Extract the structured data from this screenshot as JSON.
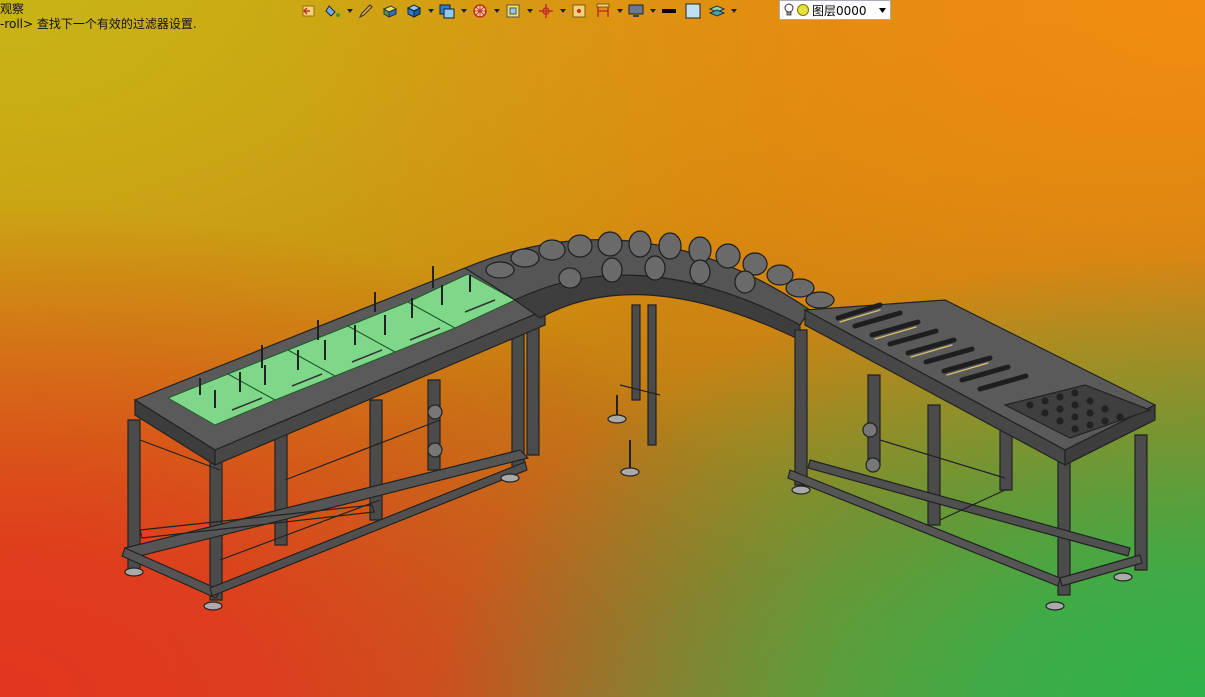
{
  "status": {
    "line1": "观察",
    "line2": "-roll> 查找下一个有效的过滤器设置."
  },
  "toolbar": {
    "buttons": [
      {
        "icon": "view-back-icon",
        "dropdown": false
      },
      {
        "icon": "paint-bucket-icon",
        "dropdown": true
      },
      {
        "icon": "pen-edit-icon",
        "dropdown": false
      },
      {
        "icon": "shaded-box-icon",
        "dropdown": false
      },
      {
        "icon": "solid-cube-icon",
        "dropdown": true
      },
      {
        "icon": "display-mode-icon",
        "dropdown": true
      },
      {
        "icon": "section-wheel-icon",
        "dropdown": true
      },
      {
        "icon": "frame-view-icon",
        "dropdown": true
      },
      {
        "icon": "origin-axis-icon",
        "dropdown": true
      },
      {
        "icon": "point-snap-icon",
        "dropdown": false
      },
      {
        "icon": "dimension-icon",
        "dropdown": true
      },
      {
        "icon": "monitor-icon",
        "dropdown": true
      },
      {
        "icon": "line-style-icon",
        "dropdown": false
      },
      {
        "icon": "color-swatch-icon",
        "dropdown": false
      },
      {
        "icon": "layers-icon",
        "dropdown": true
      }
    ]
  },
  "layer": {
    "name": "图层0000"
  },
  "colors": {
    "frame": "#4a4a4a",
    "frame_dark": "#2a2a2a",
    "plate": "#7fd88a",
    "roller": "#6a6a6a"
  }
}
